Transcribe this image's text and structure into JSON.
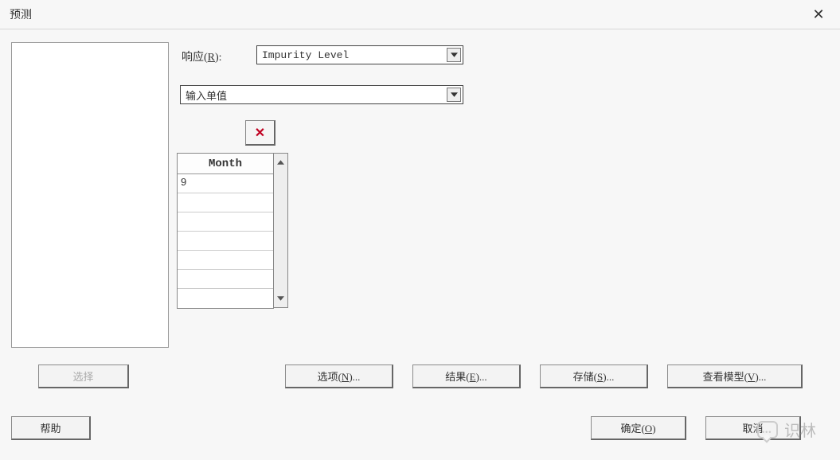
{
  "window": {
    "title": "预测"
  },
  "fields": {
    "response_label_pre": "响应(",
    "response_label_hot": "R",
    "response_label_post": "):",
    "response_value": "Impurity Level",
    "mode_value": "输入单值"
  },
  "grid": {
    "header": "Month",
    "rows": [
      "9",
      "",
      "",
      "",
      "",
      "",
      ""
    ]
  },
  "buttons": {
    "select": "选择",
    "options": "选项(N)...",
    "results": "结果(E)...",
    "store": "存储(S)...",
    "viewmodel": "查看模型(V)...",
    "help": "帮助",
    "ok": "确定(O)",
    "cancel": "取消"
  },
  "watermark": "识林"
}
